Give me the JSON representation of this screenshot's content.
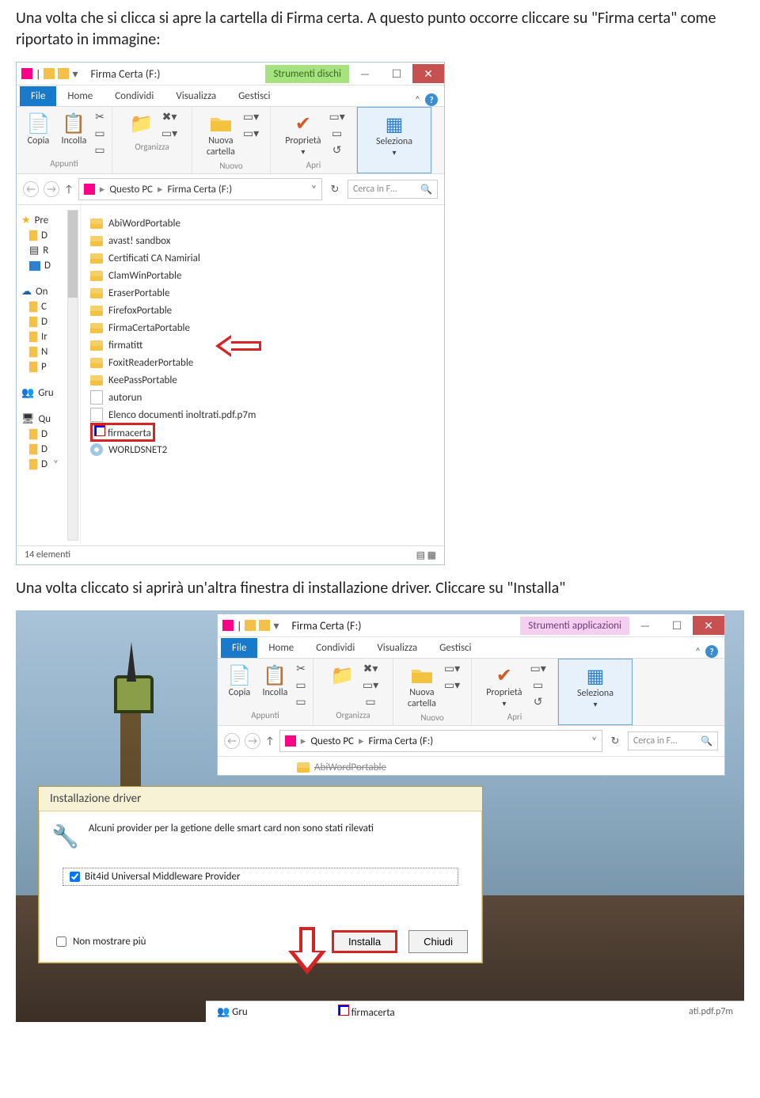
{
  "paragraphs": {
    "p1": "Una volta che si clicca si apre la cartella di Firma certa. A questo punto occorre cliccare su \"Firma certa\" come riportato in immagine:",
    "p2": "Una volta cliccato si aprirà un'altra finestra di installazione driver. Cliccare su \"Installa\""
  },
  "window1": {
    "title": "Firma Certa (F:)",
    "contextTab": "Strumenti dischi",
    "tabs": {
      "file": "File",
      "home": "Home",
      "condividi": "Condividi",
      "visualizza": "Visualizza",
      "gestisci": "Gestisci"
    },
    "ribbon": {
      "copia": "Copia",
      "incolla": "Incolla",
      "appunti": "Appunti",
      "organizza": "Organizza",
      "nuovaCartella": "Nuova\ncartella",
      "nuovo": "Nuovo",
      "proprieta": "Proprietà",
      "apri": "Apri",
      "seleziona": "Seleziona"
    },
    "breadcrumb": {
      "pc": "Questo PC",
      "drive": "Firma Certa (F:)"
    },
    "searchPlaceholder": "Cerca in F…",
    "navItems": [
      "Pre",
      "D",
      "R",
      "D",
      "On",
      "C",
      "D",
      "Ir",
      "N",
      "P",
      "Gru",
      "Qu",
      "D",
      "D",
      "D"
    ],
    "files": [
      {
        "t": "folder",
        "n": "AbiWordPortable"
      },
      {
        "t": "folder",
        "n": "avast! sandbox"
      },
      {
        "t": "folder",
        "n": "Certificati CA Namirial"
      },
      {
        "t": "folder",
        "n": "ClamWinPortable"
      },
      {
        "t": "folder",
        "n": "EraserPortable"
      },
      {
        "t": "folder",
        "n": "FirefoxPortable"
      },
      {
        "t": "folder",
        "n": "FirmaCertaPortable"
      },
      {
        "t": "folder",
        "n": "firmatitt"
      },
      {
        "t": "folder",
        "n": "FoxitReaderPortable"
      },
      {
        "t": "folder",
        "n": "KeePassPortable"
      },
      {
        "t": "file",
        "n": "autorun"
      },
      {
        "t": "file",
        "n": "Elenco documenti inoltrati.pdf.p7m"
      },
      {
        "t": "app",
        "n": "firmacerta",
        "hl": true
      },
      {
        "t": "cd",
        "n": "WORLDSNET2"
      }
    ],
    "status": "14 elementi"
  },
  "window2": {
    "title": "Firma Certa (F:)",
    "contextTab": "Strumenti applicazioni",
    "searchPlaceholder": "Cerca in F…",
    "peek": "AbiWordPortable"
  },
  "dialog": {
    "title": "Installazione driver",
    "message": "Alcuni provider per la getione delle smart card non sono stati rilevati",
    "provider": "Bit4id Universal Middleware Provider",
    "dontShow": "Non mostrare più",
    "installa": "Installa",
    "chiudi": "Chiudi"
  },
  "taskbar": {
    "a": "Gru",
    "b": "firmacerta",
    "c": "ati.pdf.p7m"
  }
}
